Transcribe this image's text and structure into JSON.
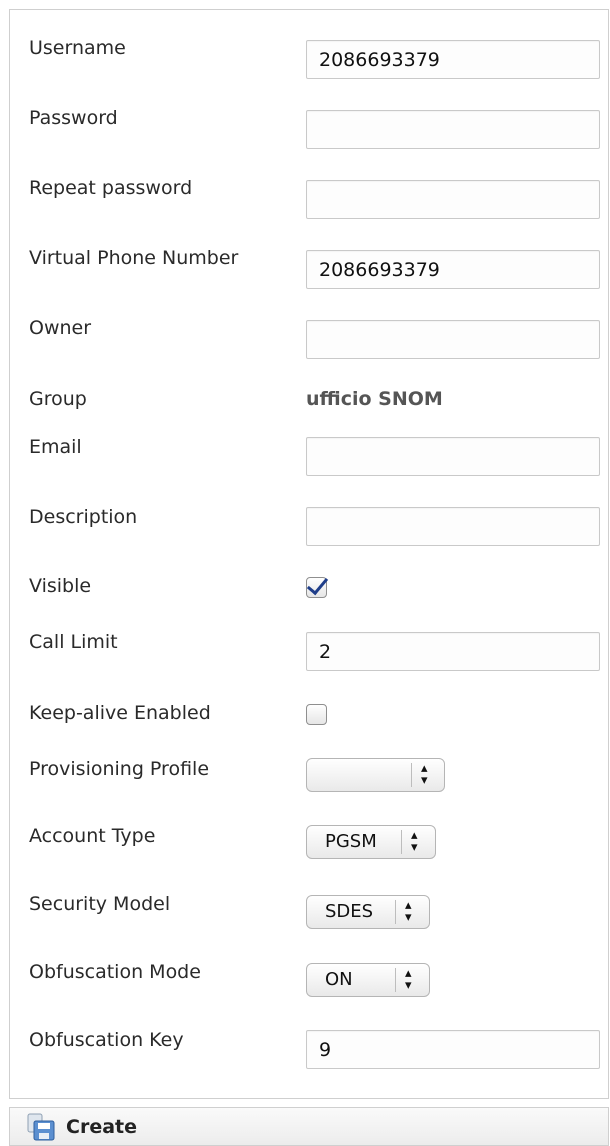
{
  "form": {
    "username": {
      "label": "Username",
      "value": "2086693379"
    },
    "password": {
      "label": "Password",
      "value": ""
    },
    "repeat_password": {
      "label": "Repeat password",
      "value": ""
    },
    "virtual_phone": {
      "label": "Virtual Phone Number",
      "value": "2086693379"
    },
    "owner": {
      "label": "Owner",
      "value": ""
    },
    "group": {
      "label": "Group",
      "value": "ufficio SNOM"
    },
    "email": {
      "label": "Email",
      "value": ""
    },
    "description": {
      "label": "Description",
      "value": ""
    },
    "visible": {
      "label": "Visible",
      "checked": true
    },
    "call_limit": {
      "label": "Call Limit",
      "value": "2"
    },
    "keep_alive": {
      "label": "Keep-alive Enabled",
      "checked": false
    },
    "provisioning_profile": {
      "label": "Provisioning Profile",
      "value": ""
    },
    "account_type": {
      "label": "Account Type",
      "value": "PGSM"
    },
    "security_model": {
      "label": "Security Model",
      "value": "SDES"
    },
    "obfuscation_mode": {
      "label": "Obfuscation Mode",
      "value": "ON"
    },
    "obfuscation_key": {
      "label": "Obfuscation Key",
      "value": "9"
    }
  },
  "footer": {
    "create_label": "Create",
    "create_icon": "save-disk-icon"
  },
  "colors": {
    "check_mark": "#1f3e8a",
    "panel_border": "#cfcfcf"
  }
}
